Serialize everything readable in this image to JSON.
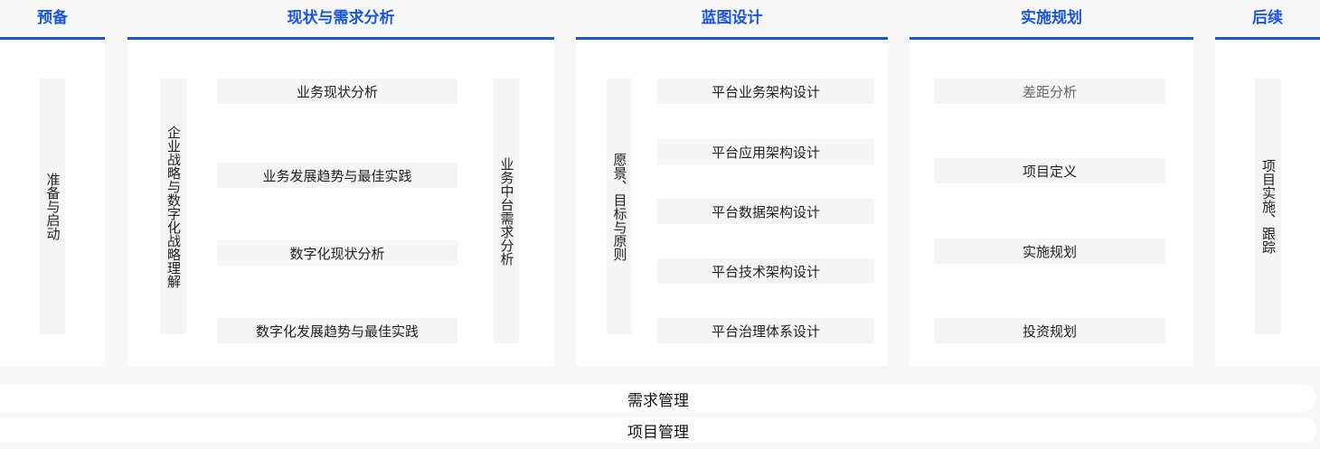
{
  "phases": {
    "prep": {
      "title": "预备",
      "vertical": "准备与启动"
    },
    "analysis": {
      "title": "现状与需求分析",
      "left_vertical": "企业战略与数字化战略理解",
      "right_vertical": "业务中台需求分析",
      "items": [
        "业务现状分析",
        "业务发展趋势与最佳实践",
        "数字化现状分析",
        "数字化发展趋势与最佳实践"
      ]
    },
    "blueprint": {
      "title": "蓝图设计",
      "vertical": "愿景、目标与原则",
      "items": [
        "平台业务架构设计",
        "平台应用架构设计",
        "平台数据架构设计",
        "平台技术架构设计",
        "平台治理体系设计"
      ]
    },
    "implementation": {
      "title": "实施规划",
      "items": [
        "差距分析",
        "项目定义",
        "实施规划",
        "投资规划"
      ]
    },
    "follow": {
      "title": "后续",
      "vertical": "项目实施、跟踪"
    }
  },
  "bars": {
    "requirements": "需求管理",
    "project": "项目管理"
  },
  "colors": {
    "accent": "#1a56db",
    "background": "#f7f7f8",
    "panel": "#ffffff",
    "box": "#f5f5f5"
  }
}
